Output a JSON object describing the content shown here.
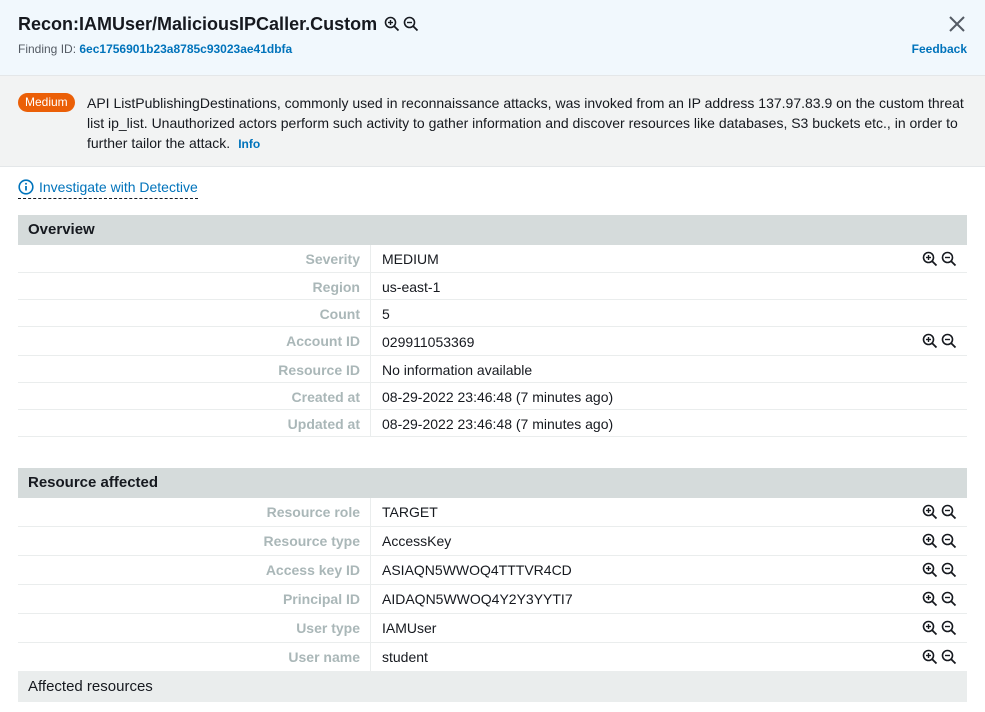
{
  "header": {
    "title": "Recon:IAMUser/MaliciousIPCaller.Custom",
    "finding_id_label": "Finding ID:",
    "finding_id_value": "6ec1756901b23a8785c93023ae41dbfa",
    "feedback_label": "Feedback"
  },
  "summary": {
    "severity_badge": "Medium",
    "description": "API ListPublishingDestinations, commonly used in reconnaissance attacks, was invoked from an IP address 137.97.83.9 on the custom threat list ip_list. Unauthorized actors perform such activity to gather information and discover resources like databases, S3 buckets etc., in order to further tailor the attack.",
    "info_label": "Info"
  },
  "investigate": {
    "label": "Investigate with Detective"
  },
  "overview": {
    "title": "Overview",
    "rows": [
      {
        "label": "Severity",
        "value": "MEDIUM"
      },
      {
        "label": "Region",
        "value": "us-east-1"
      },
      {
        "label": "Count",
        "value": "5"
      },
      {
        "label": "Account ID",
        "value": "029911053369"
      },
      {
        "label": "Resource ID",
        "value": "No information available"
      },
      {
        "label": "Created at",
        "value": "08-29-2022 23:46:48 (7 minutes ago)"
      },
      {
        "label": "Updated at",
        "value": "08-29-2022 23:46:48 (7 minutes ago)"
      }
    ]
  },
  "resource": {
    "title": "Resource affected",
    "rows": [
      {
        "label": "Resource role",
        "value": "TARGET"
      },
      {
        "label": "Resource type",
        "value": "AccessKey"
      },
      {
        "label": "Access key ID",
        "value": "ASIAQN5WWOQ4TTTVR4CD"
      },
      {
        "label": "Principal ID",
        "value": "AIDAQN5WWOQ4Y2Y3YYTI7"
      },
      {
        "label": "User type",
        "value": "IAMUser"
      },
      {
        "label": "User name",
        "value": "student"
      }
    ]
  },
  "affected_resources": {
    "label": "Affected resources"
  },
  "colors": {
    "link": "#0073bb",
    "badge": "#eb5f07",
    "header_bg": "#f1f8fd",
    "section_bg": "#d5dbdb"
  },
  "icons": [
    "zoom-in-icon",
    "zoom-out-icon",
    "close-icon",
    "info-circle-icon"
  ]
}
